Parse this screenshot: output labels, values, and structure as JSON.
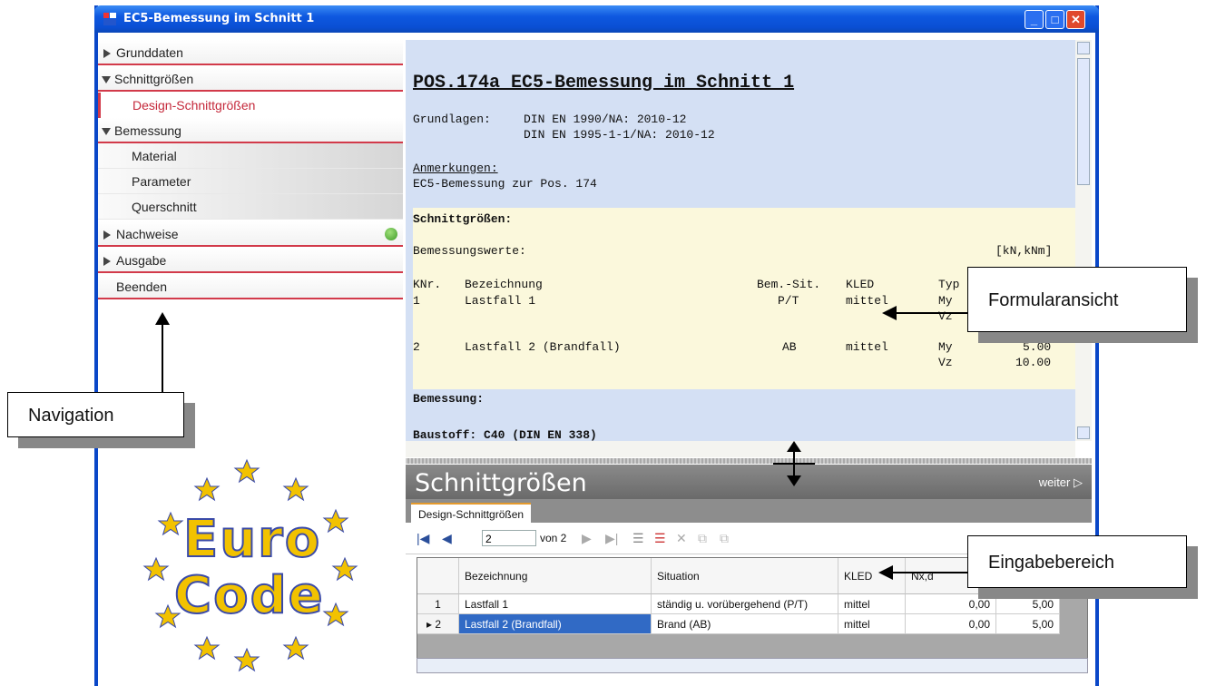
{
  "window": {
    "title": "EC5-Bemessung im Schnitt 1",
    "min": "_",
    "max": "□",
    "close": "✕"
  },
  "navigation": {
    "items": [
      {
        "label": "Grunddaten"
      },
      {
        "label": "Schnittgrößen"
      },
      {
        "label": "Design-Schnittgrößen"
      },
      {
        "label": "Bemessung"
      },
      {
        "label": "Material"
      },
      {
        "label": "Parameter"
      },
      {
        "label": "Querschnitt"
      },
      {
        "label": "Nachweise"
      },
      {
        "label": "Ausgabe"
      },
      {
        "label": "Beenden"
      }
    ]
  },
  "document": {
    "heading": "POS.174a EC5-Bemessung im Schnitt 1",
    "grundlagen_label": "Grundlagen:",
    "grundlagen_1": "DIN EN 1990/NA: 2010-12",
    "grundlagen_2": "DIN EN 1995-1-1/NA: 2010-12",
    "anmerkungen_label": "Anmerkungen:",
    "anmerkungen_text": "EC5-Bemessung zur Pos. 174",
    "schnittgroessen": "Schnittgrößen:",
    "bemessungswerte": "Bemessungswerte:",
    "unit": "[kN,kNm]",
    "col_knr": "KNr.",
    "col_bez": "Bezeichnung",
    "col_sit": "Bem.-Sit.",
    "col_kled": "KLED",
    "col_typ": "Typ",
    "r1_nr": "1",
    "r1_bez": "Lastfall 1",
    "r1_sit": "P/T",
    "r1_kled": "mittel",
    "r1_typ1": "My",
    "r1_typ2": "Vz",
    "r2_nr": "2",
    "r2_bez": "Lastfall 2 (Brandfall)",
    "r2_sit": "AB",
    "r2_kled": "mittel",
    "r2_typ1": "My",
    "r2_typ2": "Vz",
    "r2_val1": "5.00",
    "r2_val2": "10.00",
    "bemessung": "Bemessung:",
    "baustoff": "Baustoff: C40 (DIN EN 338)"
  },
  "input_area": {
    "section_title": "Schnittgrößen",
    "weiter": "weiter",
    "tab": "Design-Schnittgrößen",
    "record": "2",
    "of": "von 2",
    "headers": [
      "Bezeichnung",
      "Situation",
      "KLED",
      "Nx,d"
    ],
    "rows": [
      {
        "nr": "1",
        "bez": "Lastfall 1",
        "sit": "ständig u. vorübergehend (P/T)",
        "kled": "mittel",
        "v1": "0,00",
        "v2": "5,00"
      },
      {
        "nr": "2",
        "bez": "Lastfall 2 (Brandfall)",
        "sit": "Brand (AB)",
        "kled": "mittel",
        "v1": "0,00",
        "v2": "5,00"
      }
    ]
  },
  "callouts": {
    "navigation": "Navigation",
    "formular": "Formularansicht",
    "eingabe": "Eingabebereich"
  },
  "logo": {
    "line1": "Euro",
    "line2": "Code"
  },
  "colors": {
    "accent": "#d23a4a",
    "title_bar": "#0a4fd4",
    "doc_bg": "#d4e0f4",
    "doc_highlight": "#fbf8dc",
    "logo": "#f2c200"
  }
}
